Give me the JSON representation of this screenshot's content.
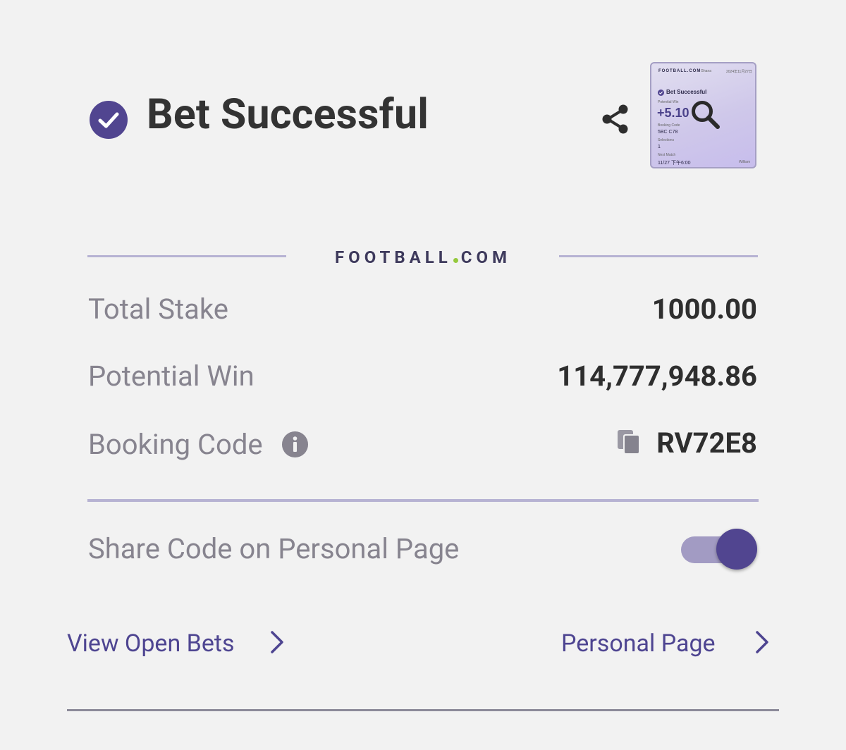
{
  "header": {
    "title": "Bet Successful",
    "icons": [
      "check-circle-icon",
      "share-icon"
    ]
  },
  "thumbnail": {
    "brand": "FOOTBALL.COM",
    "country": "Ghana",
    "date": "2024年11月27日",
    "title": "Bet Successful",
    "potential_win_label": "Potential Win",
    "potential_win_value": "+5.10",
    "booking_code_label": "Booking Code",
    "booking_code_value": "5BC C78",
    "selections_label": "Selections",
    "selections_value": "1",
    "next_match_label": "Next Match",
    "next_match_value": "11/27 下午6:00",
    "user": "William",
    "icon": "magnifier-icon"
  },
  "brand": {
    "left": "FOOTBALL",
    "right": "COM",
    "dot_color": "#95c93d"
  },
  "rows": {
    "total_stake_label": "Total Stake",
    "total_stake_value": "1000.00",
    "potential_win_label": "Potential Win",
    "potential_win_value": "114,777,948.86",
    "booking_code_label": "Booking Code",
    "booking_code_value": "RV72E8"
  },
  "share_toggle": {
    "label": "Share Code on Personal Page",
    "enabled": true
  },
  "links": {
    "view_open_bets": "View Open Bets",
    "personal_page": "Personal Page"
  },
  "colors": {
    "accent": "#514590",
    "link": "#4e4591",
    "divider": "#b7b3d3"
  }
}
